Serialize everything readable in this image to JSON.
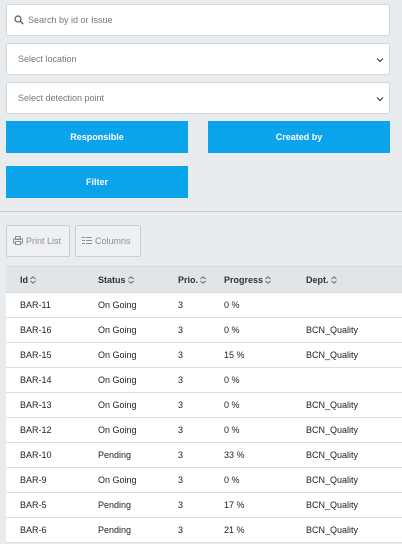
{
  "search": {
    "placeholder": "Search by id or Issue"
  },
  "location_select": {
    "value": "Select location"
  },
  "detection_select": {
    "value": "Select detection point"
  },
  "buttons": {
    "responsible": "Responsible",
    "created_by": "Created by",
    "filter": "Filter"
  },
  "toolbar": {
    "print_list": "Print List",
    "columns": "Columns"
  },
  "table": {
    "headers": {
      "id": "Id",
      "status": "Status",
      "prio": "Prio.",
      "progress": "Progress",
      "dept": "Dept."
    },
    "rows": [
      {
        "id": "BAR-11",
        "status": "On Going",
        "prio": "3",
        "progress": "0 %",
        "dept": ""
      },
      {
        "id": "BAR-16",
        "status": "On Going",
        "prio": "3",
        "progress": "0 %",
        "dept": "BCN_Quality"
      },
      {
        "id": "BAR-15",
        "status": "On Going",
        "prio": "3",
        "progress": "15 %",
        "dept": "BCN_Quality"
      },
      {
        "id": "BAR-14",
        "status": "On Going",
        "prio": "3",
        "progress": "0 %",
        "dept": ""
      },
      {
        "id": "BAR-13",
        "status": "On Going",
        "prio": "3",
        "progress": "0 %",
        "dept": "BCN_Quality"
      },
      {
        "id": "BAR-12",
        "status": "On Going",
        "prio": "3",
        "progress": "0 %",
        "dept": "BCN_Quality"
      },
      {
        "id": "BAR-10",
        "status": "Pending",
        "prio": "3",
        "progress": "33 %",
        "dept": "BCN_Quality"
      },
      {
        "id": "BAR-9",
        "status": "On Going",
        "prio": "3",
        "progress": "0 %",
        "dept": "BCN_Quality"
      },
      {
        "id": "BAR-5",
        "status": "Pending",
        "prio": "3",
        "progress": "17 %",
        "dept": "BCN_Quality"
      },
      {
        "id": "BAR-6",
        "status": "Pending",
        "prio": "3",
        "progress": "21 %",
        "dept": "BCN_Quality"
      }
    ]
  },
  "icons": {
    "search": "search-icon",
    "chevron": "chevron-down-icon",
    "print": "printer-icon",
    "columns": "columns-icon",
    "sort": "sort-icon"
  },
  "colors": {
    "accent": "#0ba3ea",
    "background": "#e9ecef"
  }
}
